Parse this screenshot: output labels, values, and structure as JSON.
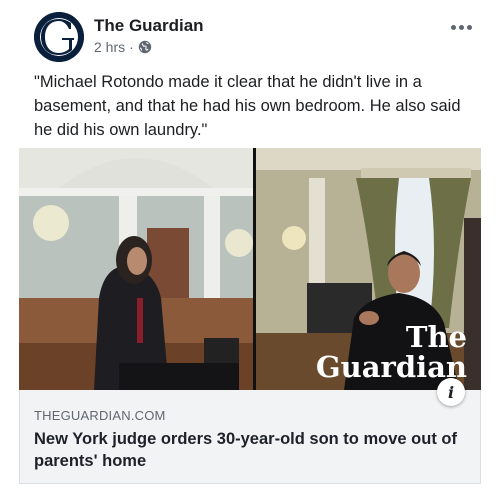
{
  "post": {
    "page_name": "The Guardian",
    "timestamp": "2 hrs",
    "separator": "·",
    "privacy_icon": "globe-icon",
    "more_icon": "ellipsis-icon",
    "text": "\"Michael Rotondo made it clear that he didn't live in a basement, and that he had his own bedroom. He also said he did his own laundry.\""
  },
  "media": {
    "logo_line1": "The",
    "logo_line2": "Guardian",
    "info_label": "i"
  },
  "link": {
    "domain": "THEGUARDIAN.COM",
    "headline": "New York judge orders 30-year-old son to move out of parents' home"
  },
  "colors": {
    "avatar_bg": "#0a1f3b",
    "link_bg": "#f2f3f5",
    "meta_text": "#616770"
  }
}
